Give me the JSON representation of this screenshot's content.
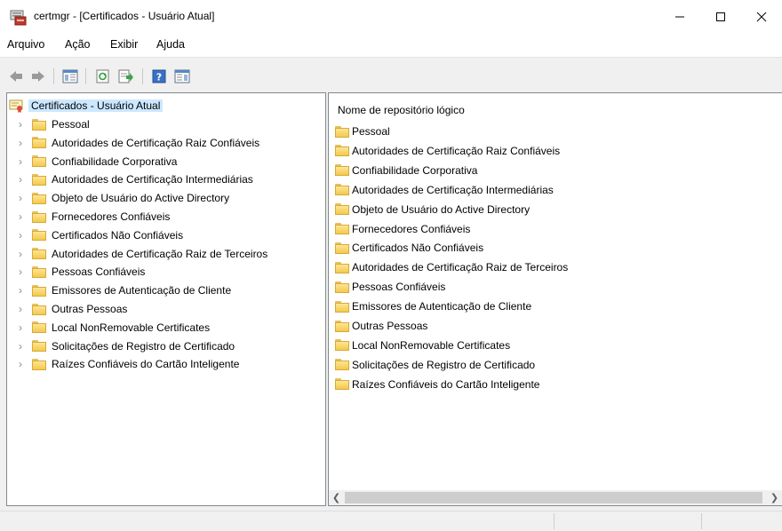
{
  "window": {
    "title": "certmgr - [Certificados - Usuário Atual]",
    "minimize": "—",
    "maximize": "☐",
    "close": "✕"
  },
  "menu": [
    "Arquivo",
    "Ação",
    "Exibir",
    "Ajuda"
  ],
  "toolbar": {
    "icons": [
      "back-icon",
      "forward-icon",
      "show-hide-tree-icon",
      "refresh-icon",
      "export-list-icon",
      "help-icon",
      "show-hide-action-pane-icon"
    ]
  },
  "tree": {
    "root": "Certificados - Usuário Atual",
    "items": [
      "Pessoal",
      "Autoridades de Certificação Raiz Confiáveis",
      "Confiabilidade Corporativa",
      "Autoridades de Certificação Intermediárias",
      "Objeto de Usuário do Active Directory",
      "Fornecedores Confiáveis",
      "Certificados Não Confiáveis",
      "Autoridades de Certificação Raiz de Terceiros",
      "Pessoas Confiáveis",
      "Emissores de Autenticação de Cliente",
      "Outras Pessoas",
      "Local NonRemovable Certificates",
      "Solicitações de Registro de Certificado",
      "Raízes Confiáveis do Cartão Inteligente"
    ]
  },
  "list": {
    "column_header": "Nome de repositório lógico",
    "items": [
      "Pessoal",
      "Autoridades de Certificação Raiz Confiáveis",
      "Confiabilidade Corporativa",
      "Autoridades de Certificação Intermediárias",
      "Objeto de Usuário do Active Directory",
      "Fornecedores Confiáveis",
      "Certificados Não Confiáveis",
      "Autoridades de Certificação Raiz de Terceiros",
      "Pessoas Confiáveis",
      "Emissores de Autenticação de Cliente",
      "Outras Pessoas",
      "Local NonRemovable Certificates",
      "Solicitações de Registro de Certificado",
      "Raízes Confiáveis do Cartão Inteligente"
    ]
  },
  "colors": {
    "selection": "#cce8ff",
    "folder": "#f2c94c",
    "border": "#828790"
  }
}
